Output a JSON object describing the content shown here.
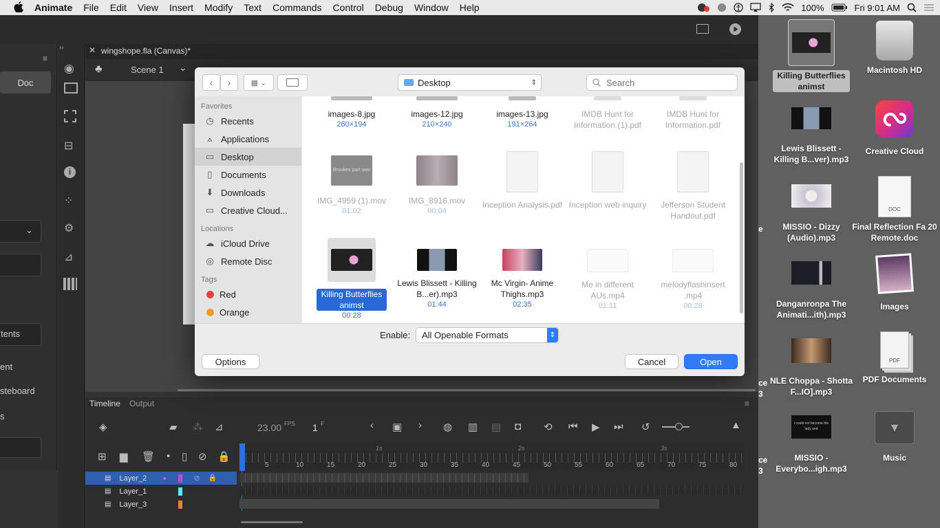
{
  "menubar": {
    "apple": "",
    "app": "Animate",
    "items": [
      "File",
      "Edit",
      "View",
      "Insert",
      "Modify",
      "Text",
      "Commands",
      "Control",
      "Debug",
      "Window",
      "Help"
    ],
    "battery": "100%",
    "clock": "Fri 9:01 AM"
  },
  "animate": {
    "tab_title": "wingshope.fla (Canvas)*",
    "scene": "Scene 1",
    "doc_button": "Doc",
    "left_texts": [
      "tents",
      "ent",
      "steboard",
      "s"
    ],
    "timeline_tab": "Timeline",
    "output_tab": "Output",
    "fps": "23.00",
    "fps_unit": "FPS",
    "frame": "1",
    "frame_unit": "F",
    "ruler_labels": [
      "5",
      "10",
      "15",
      "20",
      "25",
      "30",
      "35",
      "40",
      "45",
      "50",
      "55",
      "60",
      "65",
      "70",
      "75",
      "80"
    ],
    "second_marks": [
      "1s",
      "2s",
      "3s"
    ],
    "layers": [
      "Layer_2",
      "Layer_1",
      "Layer_3"
    ]
  },
  "dialog": {
    "location": "Desktop",
    "search_placeholder": "Search",
    "sidebar": {
      "favorites_header": "Favorites",
      "favorites": [
        {
          "icon": "clock-icon",
          "label": "Recents"
        },
        {
          "icon": "applications-icon",
          "label": "Applications"
        },
        {
          "icon": "desktop-icon",
          "label": "Desktop"
        },
        {
          "icon": "document-icon",
          "label": "Documents"
        },
        {
          "icon": "download-icon",
          "label": "Downloads"
        },
        {
          "icon": "folder-icon",
          "label": "Creative Cloud..."
        }
      ],
      "locations_header": "Locations",
      "locations": [
        {
          "icon": "cloud-icon",
          "label": "iCloud Drive"
        },
        {
          "icon": "disc-icon",
          "label": "Remote Disc"
        }
      ],
      "tags_header": "Tags",
      "tags": [
        {
          "label": "Red",
          "color": "#e84040"
        },
        {
          "label": "Orange",
          "color": "#f39a2e"
        }
      ]
    },
    "files": [
      {
        "name": "images-8.jpg",
        "meta": "260×194",
        "dim": false
      },
      {
        "name": "images-12.jpg",
        "meta": "210×240",
        "dim": false
      },
      {
        "name": "images-13.jpg",
        "meta": "191×264",
        "dim": false
      },
      {
        "name": "IMDB Hunt for Information (1).pdf",
        "meta": "",
        "dim": true
      },
      {
        "name": "IMDB Hunt for Information.pdf",
        "meta": "",
        "dim": true
      },
      {
        "name": "IMG_4959 (1).mov",
        "meta": "01:02",
        "dim": true,
        "thumb_text": "Brookes part uwu"
      },
      {
        "name": "IMG_8916.mov",
        "meta": "00:04",
        "dim": true
      },
      {
        "name": "Inception Analysis.pdf",
        "meta": "",
        "dim": true
      },
      {
        "name": "Inception web inquiry",
        "meta": "",
        "dim": true
      },
      {
        "name": "Jefferson Student Handout.pdf",
        "meta": "",
        "dim": true
      },
      {
        "name": "Killing Butterflies animst",
        "meta": "00:28",
        "dim": false,
        "selected": true
      },
      {
        "name": "Lewis Blissett - Killing B...er).mp3",
        "meta": "01:44",
        "dim": false
      },
      {
        "name": "Mc Virgin- Anime Thighs.mp3",
        "meta": "02:35",
        "dim": false
      },
      {
        "name": "Me in different AUs.mp4",
        "meta": "01:11",
        "dim": true
      },
      {
        "name": "melodyflashinsert .mp4",
        "meta": "00:28",
        "dim": true
      }
    ],
    "enable_label": "Enable:",
    "enable_value": "All Openable Formats",
    "options_button": "Options",
    "cancel_button": "Cancel",
    "open_button": "Open"
  },
  "desktop": {
    "icons": [
      {
        "label": "Killing Butterflies animst",
        "selected": true
      },
      {
        "label": "Macintosh HD"
      },
      {
        "label": "Lewis Blissett - Killing B...ver).mp3"
      },
      {
        "label": "Creative Cloud"
      },
      {
        "label": "MISSIO - Dizzy (Audio).mp3"
      },
      {
        "label": "Final Reflection Fa 20 Remote.doc"
      },
      {
        "label": "Danganronpa The Animati...ith).mp3"
      },
      {
        "label": "Images"
      },
      {
        "label": "NLE Choppa - Shotta F...IO].mp3"
      },
      {
        "label": "PDF Documents"
      },
      {
        "label": "MISSIO - Everybo...igh.mp3"
      },
      {
        "label": "Music"
      }
    ],
    "cut_texts": [
      "e",
      "ce",
      "3",
      "ce",
      "3"
    ],
    "doc_tag": "DOC",
    "pdf_tag": "PDF",
    "thumb_caption": "i could not become the lady and"
  }
}
